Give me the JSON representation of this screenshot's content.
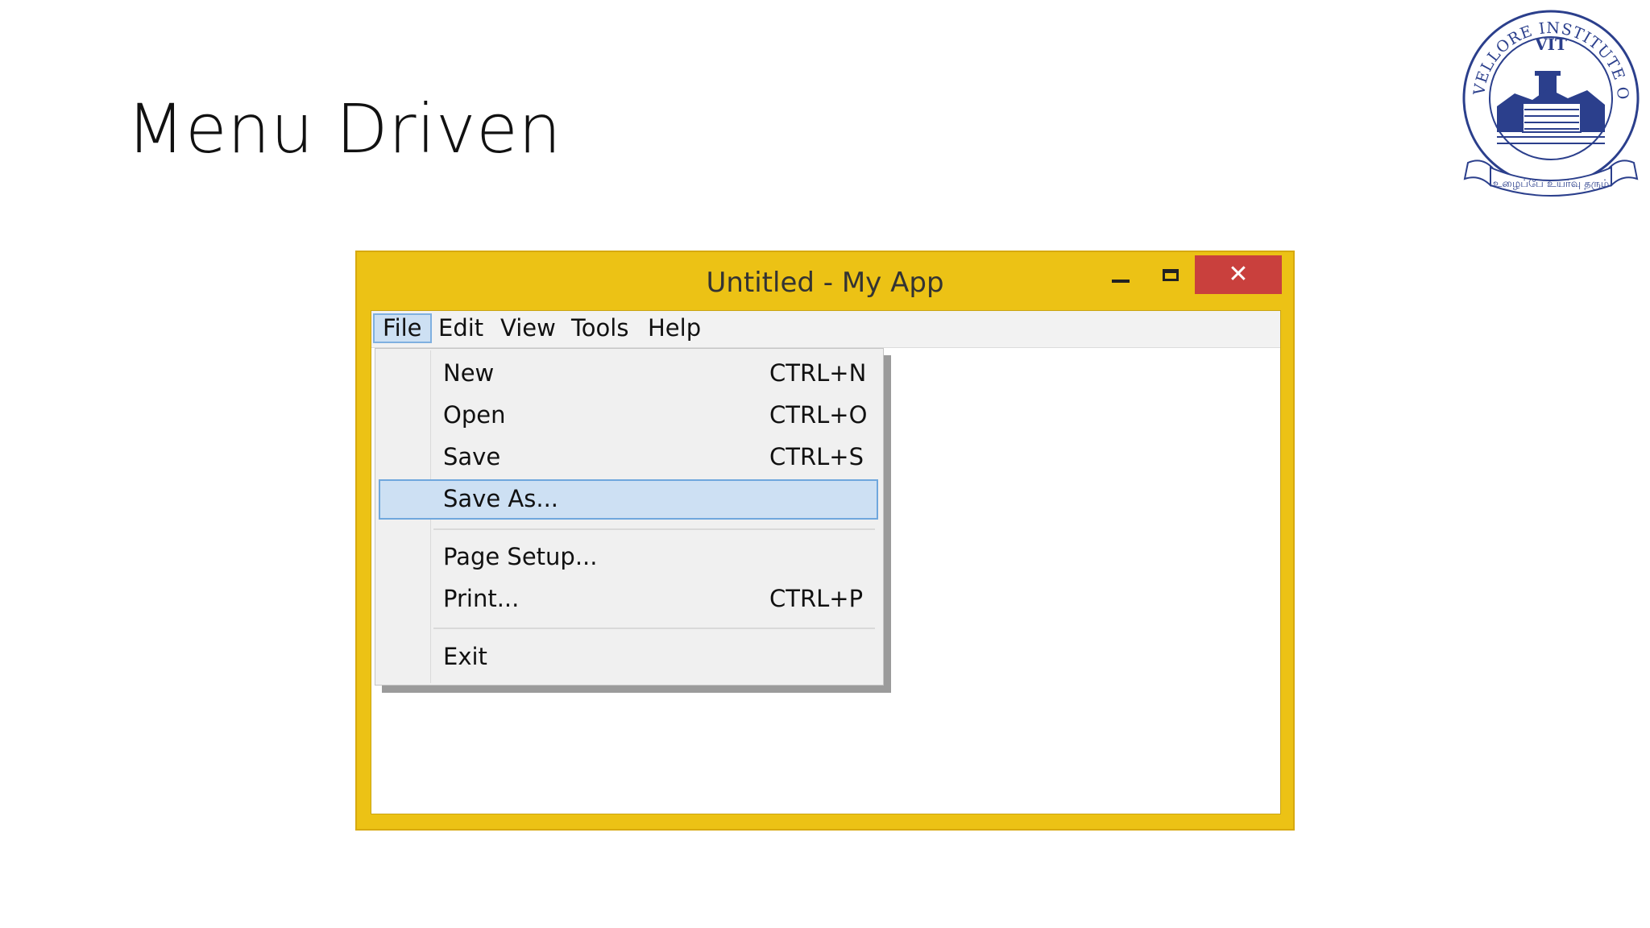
{
  "slide": {
    "title": "Menu Driven"
  },
  "logo": {
    "ring_text": "VELLORE INSTITUTE OF TECHNOLOGY",
    "abbr": "VIT",
    "motto": "உழைப்பே உயர்வு தரும்"
  },
  "window": {
    "title": "Untitled - My App",
    "frame_color": "#ecc215",
    "close_color": "#c9403d",
    "controls": {
      "minimize": "minimize-icon",
      "maximize": "maximize-icon",
      "close": "close-icon"
    }
  },
  "menubar": {
    "items": [
      {
        "label": "File",
        "active": true
      },
      {
        "label": "Edit",
        "active": false
      },
      {
        "label": "View",
        "active": false
      },
      {
        "label": "Tools",
        "active": false
      },
      {
        "label": "Help",
        "active": false
      }
    ]
  },
  "file_menu": {
    "items": [
      {
        "label": "New",
        "shortcut": "CTRL+N"
      },
      {
        "label": "Open",
        "shortcut": "CTRL+O"
      },
      {
        "label": "Save",
        "shortcut": "CTRL+S"
      },
      {
        "label": "Save As...",
        "shortcut": "",
        "highlighted": true
      },
      {
        "label": "Page Setup...",
        "shortcut": ""
      },
      {
        "label": "Print...",
        "shortcut": "CTRL+P"
      },
      {
        "label": "Exit",
        "shortcut": ""
      }
    ],
    "highlight_color": "#cde0f3"
  }
}
